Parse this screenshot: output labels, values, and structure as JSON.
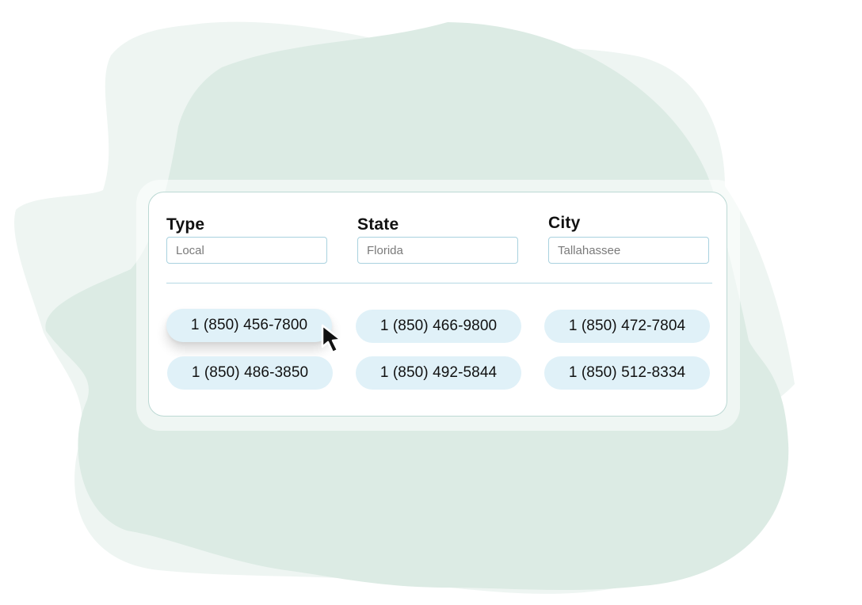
{
  "filters": [
    {
      "label": "Type",
      "value": "Local"
    },
    {
      "label": "State",
      "value": "Florida"
    },
    {
      "label": "City",
      "value": "Tallahassee"
    }
  ],
  "numbers": [
    "1 (850) 456-7800",
    "1 (850) 466-9800",
    "1 (850) 472-7804",
    "1 (850) 486-3850",
    "1 (850) 492-5844",
    "1 (850) 512-8334"
  ],
  "colors": {
    "pill_background": "#e0f1f8",
    "input_border": "#a9d2df",
    "panel_border": "#bcd9d4",
    "blob_light": "#eef5f2",
    "blob_dark": "#dcebe4"
  },
  "icons": {
    "cursor": "arrow-pointer-icon"
  }
}
